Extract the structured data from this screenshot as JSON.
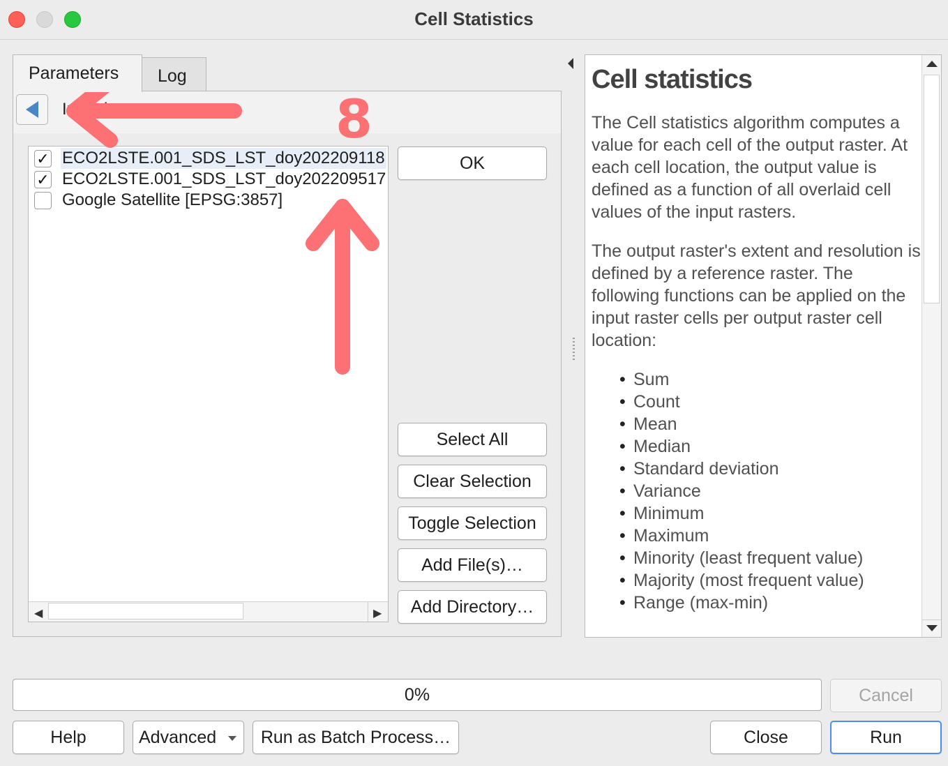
{
  "window": {
    "title": "Cell Statistics"
  },
  "tabs": [
    {
      "label": "Parameters",
      "active": true
    },
    {
      "label": "Log",
      "active": false
    }
  ],
  "panel_header": {
    "label": "Input layers"
  },
  "layers": [
    {
      "name": "ECO2LSTE.001_SDS_LST_doy202209118",
      "checked": true
    },
    {
      "name": "ECO2LSTE.001_SDS_LST_doy202209517",
      "checked": true
    },
    {
      "name": "Google Satellite [EPSG:3857]",
      "checked": false
    }
  ],
  "side_buttons": {
    "ok": "OK",
    "select_all": "Select All",
    "clear_selection": "Clear Selection",
    "toggle_selection": "Toggle Selection",
    "add_files": "Add File(s)…",
    "add_directory": "Add Directory…"
  },
  "help": {
    "title": "Cell statistics",
    "paragraph1": "The Cell statistics algorithm computes a value for each cell of the output raster. At each cell location, the output value is defined as a function of all overlaid cell values of the input rasters.",
    "paragraph2": "The output raster's extent and resolution is defined by a reference raster. The following functions can be applied on the input raster cells per output raster cell location:",
    "functions": [
      "Sum",
      "Count",
      "Mean",
      "Median",
      "Standard deviation",
      "Variance",
      "Minimum",
      "Maximum",
      "Minority (least frequent value)",
      "Majority (most frequent value)",
      "Range (max-min)"
    ]
  },
  "progress": {
    "text": "0%",
    "value": 0
  },
  "buttons": {
    "cancel": "Cancel",
    "help": "Help",
    "advanced": "Advanced",
    "run_batch": "Run as Batch Process…",
    "close": "Close",
    "run": "Run"
  },
  "annotation": {
    "step_number": "8",
    "color": "#fd7073"
  },
  "colors": {
    "accent": "#4a8ff0",
    "close_light": "#fe5f57",
    "zoom_light": "#28c840"
  }
}
